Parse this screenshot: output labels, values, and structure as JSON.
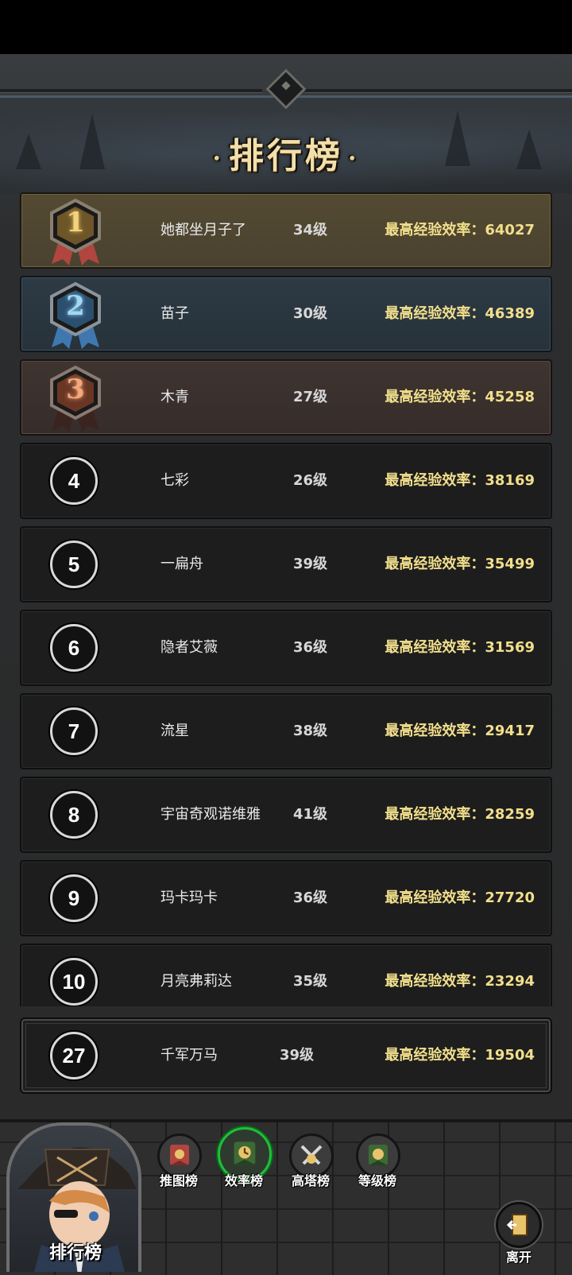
{
  "title": "排行榜",
  "title_dot": "·",
  "stat_label": "最高经验效率：",
  "rankings": [
    {
      "rank": "1",
      "name": "她都坐月子了",
      "level": "34级",
      "score": "64027",
      "tier": "gold"
    },
    {
      "rank": "2",
      "name": "苗子",
      "level": "30级",
      "score": "46389",
      "tier": "silver"
    },
    {
      "rank": "3",
      "name": "木青",
      "level": "27级",
      "score": "45258",
      "tier": "bronze"
    },
    {
      "rank": "4",
      "name": "七彩",
      "level": "26级",
      "score": "38169",
      "tier": "normal"
    },
    {
      "rank": "5",
      "name": "一扁舟",
      "level": "39级",
      "score": "35499",
      "tier": "normal"
    },
    {
      "rank": "6",
      "name": "隐者艾薇",
      "level": "36级",
      "score": "31569",
      "tier": "normal"
    },
    {
      "rank": "7",
      "name": "流星",
      "level": "38级",
      "score": "29417",
      "tier": "normal"
    },
    {
      "rank": "8",
      "name": "宇宙奇观诺维雅",
      "level": "41级",
      "score": "28259",
      "tier": "normal"
    },
    {
      "rank": "9",
      "name": "玛卡玛卡",
      "level": "36级",
      "score": "27720",
      "tier": "normal"
    },
    {
      "rank": "10",
      "name": "月亮弗莉达",
      "level": "35级",
      "score": "23294",
      "tier": "normal"
    }
  ],
  "self": {
    "rank": "27",
    "name": "千军万马",
    "level": "39级",
    "score": "19504"
  },
  "portrait_label": "排行榜",
  "tabs": [
    {
      "label": "推图榜",
      "icon": "map-banner-icon",
      "active": false
    },
    {
      "label": "效率榜",
      "icon": "clock-banner-icon",
      "active": true
    },
    {
      "label": "高塔榜",
      "icon": "crossed-swords-icon",
      "active": false
    },
    {
      "label": "等级榜",
      "icon": "level-banner-icon",
      "active": false
    }
  ],
  "exit_label": "离开",
  "colors": {
    "gold_row": "#544a32",
    "silver_row": "#2d3a44",
    "bronze_row": "#3e3430",
    "stat_text": "#f1df8c",
    "active_tab_ring": "#1fbf3a"
  }
}
